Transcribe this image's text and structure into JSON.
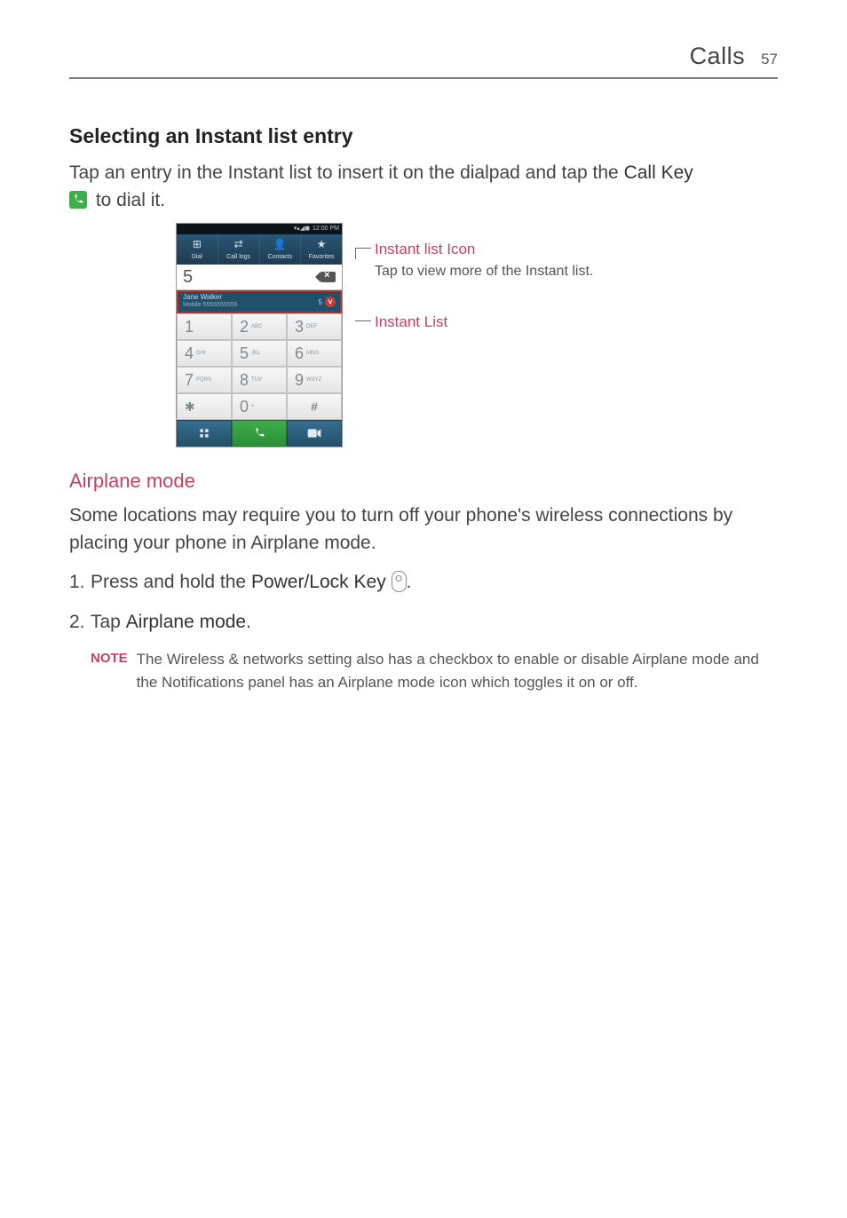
{
  "header": {
    "section": "Calls",
    "page_number": "57"
  },
  "section1": {
    "title": "Selecting an Instant list entry",
    "para_a": "Tap an entry in the Instant list to insert it on the dialpad and tap the ",
    "call_key_label": "Call Key",
    "para_b": " to dial it."
  },
  "figure": {
    "statusbar_time": "12:00 PM",
    "tabs": [
      {
        "icon": "⊞",
        "label": "Dial"
      },
      {
        "icon": "⇄",
        "label": "Call logs"
      },
      {
        "icon": "👤",
        "label": "Contacts"
      },
      {
        "icon": "★",
        "label": "Favorites"
      }
    ],
    "dialed_number": "5",
    "instant_entry": {
      "name": "Jane Walker",
      "detail": "Mobile 5555555555",
      "count": "5"
    },
    "keys": [
      {
        "main": "1",
        "sub": ""
      },
      {
        "main": "2",
        "sub": "ABC"
      },
      {
        "main": "3",
        "sub": "DEF"
      },
      {
        "main": "4",
        "sub": "GHI"
      },
      {
        "main": "5",
        "sub": "JKL"
      },
      {
        "main": "6",
        "sub": "MNO"
      },
      {
        "main": "7",
        "sub": "PQRS"
      },
      {
        "main": "8",
        "sub": "TUV"
      },
      {
        "main": "9",
        "sub": "WXYZ"
      },
      {
        "main": "✱",
        "sub": ""
      },
      {
        "main": "0",
        "sub": "+"
      },
      {
        "main": "#",
        "sub": ""
      }
    ],
    "callouts": {
      "top_title": "Instant list Icon",
      "top_desc": "Tap to view more of the Instant list.",
      "bottom_title": "Instant List"
    }
  },
  "section2": {
    "title": "Airplane mode",
    "para": "Some locations may require you to turn off your phone's wireless connections by placing your phone in Airplane mode.",
    "steps": {
      "s1_a": "Press and hold the ",
      "s1_key": "Power/Lock Key",
      "s1_b": ".",
      "s2_a": "Tap ",
      "s2_key": "Airplane mode",
      "s2_b": "."
    },
    "note_label": "NOTE",
    "note_text": "The Wireless & networks setting also has a checkbox to enable or disable Airplane mode and the Notifications panel has an Airplane mode icon which toggles it on or off."
  }
}
